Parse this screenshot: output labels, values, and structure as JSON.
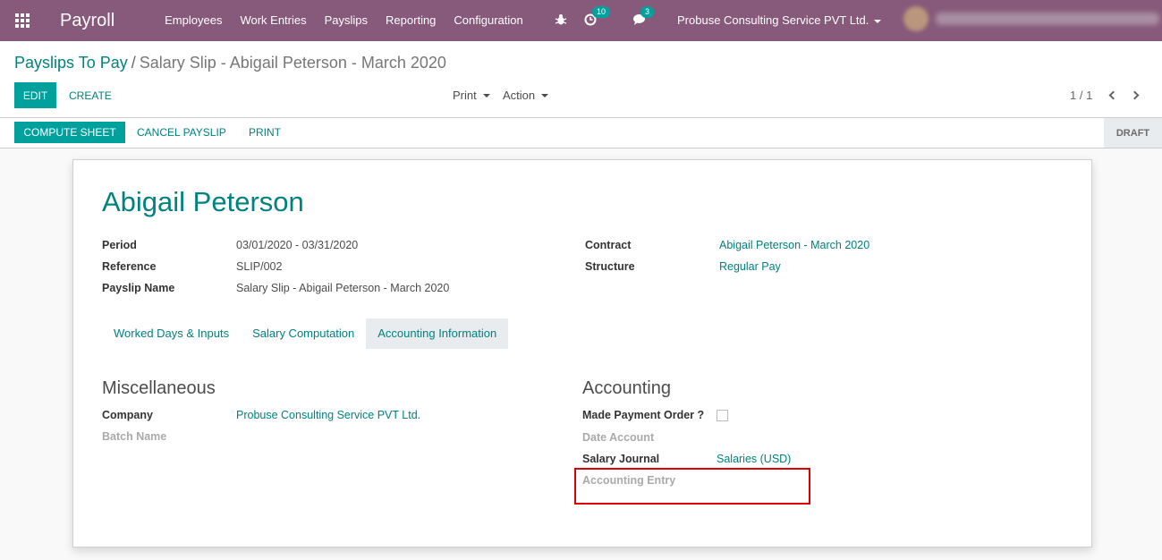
{
  "navbar": {
    "app_title": "Payroll",
    "menu": [
      "Employees",
      "Work Entries",
      "Payslips",
      "Reporting",
      "Configuration"
    ],
    "activity_count": "10",
    "messages_count": "3",
    "company": "Probuse Consulting Service PVT Ltd."
  },
  "breadcrumb": {
    "parent": "Payslips To Pay",
    "separator": "/",
    "current": "Salary Slip - Abigail Peterson - March 2020"
  },
  "buttons": {
    "edit": "EDIT",
    "create": "CREATE",
    "print_dropdown": "Print",
    "action_dropdown": "Action",
    "compute_sheet": "COMPUTE SHEET",
    "cancel_payslip": "CANCEL PAYSLIP",
    "print": "PRINT"
  },
  "pager": {
    "value": "1 / 1"
  },
  "status": {
    "draft": "DRAFT"
  },
  "form": {
    "employee_name": "Abigail Peterson",
    "fields_left": [
      {
        "label": "Period",
        "value": "03/01/2020 - 03/31/2020"
      },
      {
        "label": "Reference",
        "value": "SLIP/002"
      },
      {
        "label": "Payslip Name",
        "value": "Salary Slip - Abigail Peterson - March 2020"
      }
    ],
    "fields_right": [
      {
        "label": "Contract",
        "value": "Abigail Peterson - March 2020"
      },
      {
        "label": "Structure",
        "value": "Regular Pay"
      }
    ],
    "tabs": [
      "Worked Days & Inputs",
      "Salary Computation",
      "Accounting Information"
    ],
    "active_tab": "Accounting Information",
    "misc": {
      "title": "Miscellaneous",
      "company_label": "Company",
      "company_value": "Probuse Consulting Service PVT Ltd.",
      "batch_label": "Batch Name"
    },
    "accounting": {
      "title": "Accounting",
      "payment_order_label": "Made Payment Order ?",
      "payment_order_checked": false,
      "date_account_label": "Date Account",
      "journal_label": "Salary Journal",
      "journal_value": "Salaries (USD)",
      "entry_label": "Accounting Entry"
    }
  },
  "colors": {
    "navbar": "#875a7b",
    "primary": "#00a09d",
    "link": "#00827f",
    "highlight": "#dd0000"
  }
}
